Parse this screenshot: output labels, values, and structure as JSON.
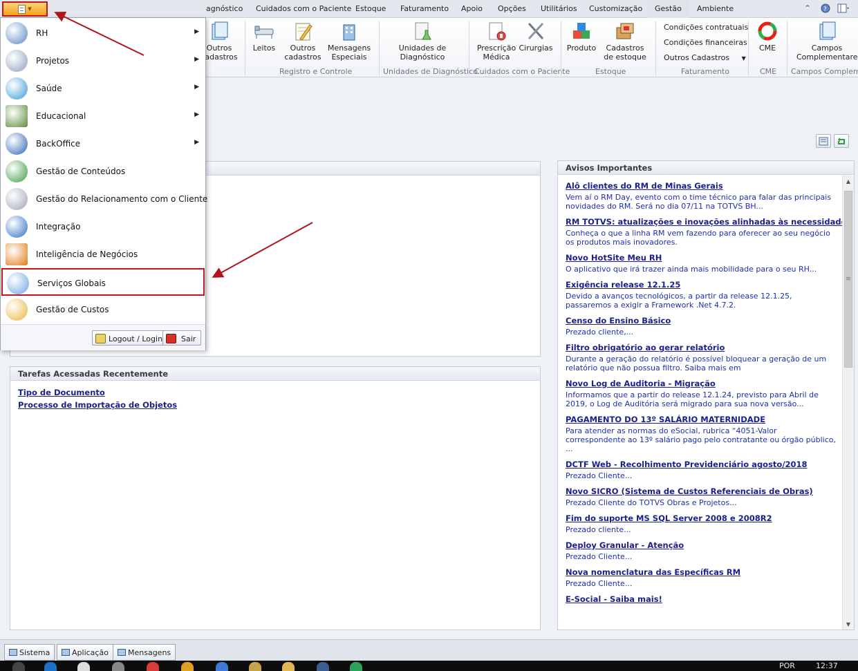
{
  "tabs": [
    {
      "label": "agnóstico",
      "name": "tab-diagnostico"
    },
    {
      "label": "Cuidados com o Paciente",
      "name": "tab-cuidados-paciente"
    },
    {
      "label": "Estoque",
      "name": "tab-estoque"
    },
    {
      "label": "Faturamento",
      "name": "tab-faturamento"
    },
    {
      "label": "Apoio",
      "name": "tab-apoio"
    },
    {
      "label": "Opções",
      "name": "tab-opcoes"
    },
    {
      "label": "Utilitários",
      "name": "tab-utilitarios"
    },
    {
      "label": "Customização",
      "name": "tab-customizacao"
    },
    {
      "label": "Gestão",
      "name": "tab-gestao"
    },
    {
      "label": "Ambiente",
      "name": "tab-ambiente"
    }
  ],
  "ribbon": {
    "outros_cadastros_1": "Outros\ncadastros",
    "leitos": "Leitos",
    "outros_cadastros_2": "Outros\ncadastros",
    "mensagens_especiais": "Mensagens\nEspeciais",
    "unidades_diagnostico": "Unidades de\nDiagnóstico",
    "prescricao_medica": "Prescrição\nMédica",
    "cirurgias": "Cirurgias",
    "produto": "Produto",
    "cadastros_estoque": "Cadastros\nde estoque",
    "condicoes_contratuais": "Condições contratuais",
    "condicoes_financeiras": "Condições financeiras",
    "outros_cadastros_fat": "Outros Cadastros",
    "cme": "CME",
    "campos_complementares": "Campos\nComplementares",
    "groups": {
      "registro": "Registro e Controle",
      "unidades": "Unidades de Diagnóstico",
      "cuidados": "Cuidados com o Paciente",
      "estoque": "Estoque",
      "faturamento": "Faturamento",
      "cme": "CME",
      "campos": "Campos Complemen"
    }
  },
  "app_menu": {
    "items": [
      {
        "label": "RH",
        "submenu": true,
        "icon": "rh-icon"
      },
      {
        "label": "Projetos",
        "submenu": true,
        "icon": "projetos-icon"
      },
      {
        "label": "Saúde",
        "submenu": true,
        "icon": "caduceus-icon"
      },
      {
        "label": "Educacional",
        "submenu": true,
        "icon": "chalkboard-icon"
      },
      {
        "label": "BackOffice",
        "submenu": true,
        "icon": "dollar-icon"
      },
      {
        "label": "Gestão de Conteúdos",
        "submenu": false,
        "icon": "globe-arrow-icon"
      },
      {
        "label": "Gestão do Relacionamento com o Cliente",
        "submenu": false,
        "icon": "satellite-icon"
      },
      {
        "label": "Integração",
        "submenu": false,
        "icon": "globe-gear-icon"
      },
      {
        "label": "Inteligência de Negócios",
        "submenu": false,
        "icon": "sigma-icon"
      },
      {
        "label": "Serviços Globais",
        "submenu": false,
        "icon": "globe-services-icon"
      },
      {
        "label": "Gestão de Custos",
        "submenu": false,
        "icon": "piggy-bank-icon"
      }
    ],
    "logout_label": "Logout / Login",
    "exit_label": "Sair"
  },
  "recent": {
    "title": "Tarefas Acessadas Recentemente",
    "links": [
      "Tipo de Documento",
      "Processo de Importação de Objetos"
    ]
  },
  "news": {
    "title": "Avisos Importantes",
    "items": [
      {
        "title": "Alô clientes do RM de Minas Gerais",
        "text": "Vem aí o RM Day, evento com o time técnico para falar das principais novidades do RM. Será no dia 07/11 na TOTVS BH..."
      },
      {
        "title": "RM TOTVS: atualizações e inovações alinhadas às necessidades do mer",
        "text": "Conheça o que a linha RM vem fazendo para oferecer ao seu negócio os produtos mais inovadores."
      },
      {
        "title": "Novo HotSite Meu RH",
        "text": "O aplicativo que irá trazer ainda mais mobilidade para o seu RH..."
      },
      {
        "title": "Exigência release 12.1.25",
        "text": "Devido a avanços tecnológicos, a partir da release 12.1.25, passaremos a exigir a Framework .Net 4.7.2."
      },
      {
        "title": "Censo do Ensino Básico",
        "text": "Prezado cliente,..."
      },
      {
        "title": "Filtro obrigatório ao gerar relatório",
        "text": "Durante a geração do relatório é possível bloquear a geração de um relatório que não possua filtro. Saiba mais em"
      },
      {
        "title": "Novo Log de Auditoria - Migração",
        "text": "Informamos que a partir do release 12.1.24, previsto para Abril de 2019, o Log de Auditória será migrado para sua nova versão..."
      },
      {
        "title": "PAGAMENTO DO 13º SALÁRIO MATERNIDADE",
        "text": "Para atender as normas do eSocial, rubrica “4051-Valor correspondente ao 13º salário pago pelo contratante ou órgão público, ..."
      },
      {
        "title": "DCTF Web - Recolhimento Previdenciário agosto/2018",
        "text": "Prezado Cliente..."
      },
      {
        "title": "Novo SICRO (Sistema de Custos Referenciais de Obras)",
        "text": "Prezado Cliente do TOTVS Obras e Projetos..."
      },
      {
        "title": "Fim do suporte MS SQL Server 2008 e 2008R2",
        "text": "Prezado cliente..."
      },
      {
        "title": "Deploy Granular - Atenção",
        "text": "Prezado Cliente..."
      },
      {
        "title": "Nova nomenclatura das Específicas RM",
        "text": "Prezado Cliente..."
      },
      {
        "title": "E-Social - Saiba mais!",
        "text": ""
      }
    ]
  },
  "bottom_tabs": [
    "Sistema",
    "Aplicação",
    "Mensagens"
  ],
  "taskbar": {
    "language": "POR",
    "time": "12:37"
  },
  "colors": {
    "highlight_border": "#c0161b",
    "arrow": "#b3141a",
    "link": "#1a1f8c",
    "news_text": "#1c2fb0"
  }
}
